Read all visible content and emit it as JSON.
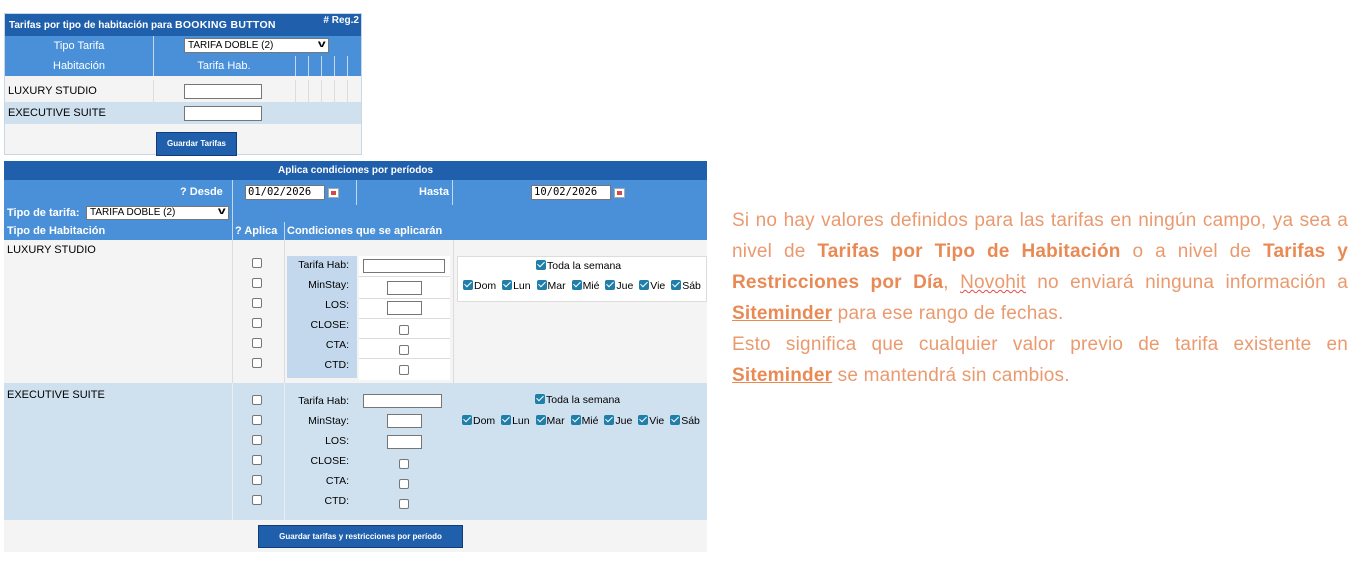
{
  "top": {
    "title_prefix": "Tarifas por tipo de habitación para ",
    "title_brand": "BOOKING BUTTON",
    "reg": "# Reg.2",
    "tipo_tarifa_label": "Tipo Tarifa",
    "tipo_tarifa_value": "TARIFA DOBLE (2)",
    "col_habitacion": "Habitación",
    "col_tarifa": "Tarifa Hab.",
    "rooms": [
      "LUXURY STUDIO",
      "EXECUTIVE SUITE"
    ],
    "save_button": "Guardar Tarifas"
  },
  "periods": {
    "title": "Aplica condiciones por períodos",
    "desde_label": "? Desde",
    "desde_value": "01/02/2026",
    "hasta_label": "Hasta",
    "hasta_value": "10/02/2026",
    "tipo_tarifa_label": "Tipo de tarifa:",
    "tipo_tarifa_value": "TARIFA DOBLE (2)",
    "col_tipo_habitacion": "Tipo de Habitación",
    "col_aplica": "? Aplica",
    "col_condiciones": "Condiciones que se aplicarán",
    "conditions": [
      "Tarifa Hab:",
      "MinStay:",
      "LOS:",
      "CLOSE:",
      "CTA:",
      "CTD:"
    ],
    "toda_semana": "Toda la semana",
    "days": [
      "Dom",
      "Lun",
      "Mar",
      "Mié",
      "Jue",
      "Vie",
      "Sáb"
    ],
    "rooms": [
      "LUXURY STUDIO",
      "EXECUTIVE SUITE"
    ],
    "save_button": "Guardar tarifas y restricciones por período"
  },
  "note": {
    "p1_a": "Si no hay valores definidos para las tarifas en ningún campo, ya sea a nivel de ",
    "p1_b": "Tarifas por Tipo de Habitación",
    "p1_c": " o a nivel de ",
    "p1_d": "Tarifas y Restricciones por Día",
    "p1_e": ", ",
    "p1_f": "Novohit",
    "p1_g": " no enviará ninguna información a ",
    "p1_h": "Siteminder",
    "p1_i": " para ese rango de fechas.",
    "p2_a": "Esto significa que cualquier valor previo de tarifa existente en ",
    "p2_b": "Siteminder",
    "p2_c": " se mantendrá sin cambios."
  },
  "colors": {
    "header_dark": "#1f5fab",
    "header_light": "#4a90d9",
    "row_alt": "#cfe0ef",
    "note_text": "#ea9a6e"
  }
}
